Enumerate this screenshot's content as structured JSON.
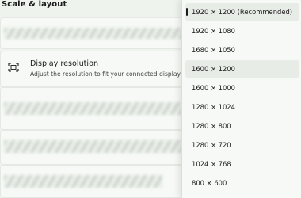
{
  "section": {
    "title": "Scale & layout"
  },
  "display_resolution": {
    "title": "Display resolution",
    "description": "Adjust the resolution to fit your connected display"
  },
  "dropdown": {
    "options": [
      "1920 × 1200 (Recommended)",
      "1920 × 1080",
      "1680 × 1050",
      "1600 × 1200",
      "1600 × 1000",
      "1280 × 1024",
      "1280 × 800",
      "1280 × 720",
      "1024 × 768",
      "800 × 600"
    ],
    "selected_index": 0,
    "highlighted_index": 3
  },
  "icons": {
    "display": "display-resolution-icon"
  }
}
